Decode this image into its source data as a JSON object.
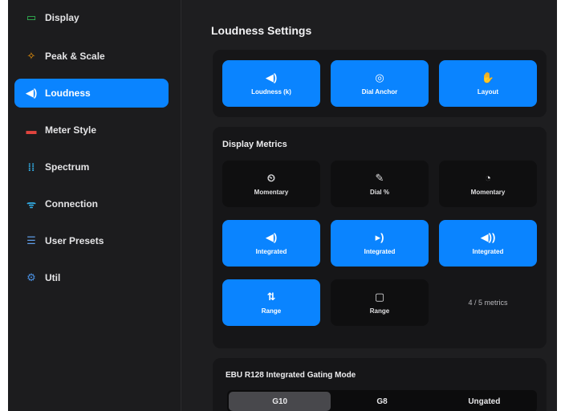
{
  "sidebar": {
    "items": [
      {
        "label": "Display",
        "icon": "monitor-icon",
        "color": "#34c759",
        "glyph": "▭"
      },
      {
        "label": "Peak & Scale",
        "icon": "peak-scale-icon",
        "color": "#ff9f0a",
        "glyph": "✧"
      },
      {
        "label": "Loudness",
        "icon": "speaker-icon",
        "color": "#ffffff",
        "glyph": "◀)"
      },
      {
        "label": "Meter Style",
        "icon": "meter-style-icon",
        "color": "#e0443e",
        "glyph": "▬"
      },
      {
        "label": "Spectrum",
        "icon": "spectrum-icon",
        "color": "#32ade6",
        "glyph": "⁞⁞"
      },
      {
        "label": "Connection",
        "icon": "wifi-icon",
        "color": "#32ade6",
        "glyph": "ᯤ"
      },
      {
        "label": "User Presets",
        "icon": "presets-icon",
        "color": "#5e9ce6",
        "glyph": "☰"
      },
      {
        "label": "Util",
        "icon": "wrench-icon",
        "color": "#4a90e2",
        "glyph": "⚙"
      }
    ],
    "active_index": 2
  },
  "main": {
    "title": "Loudness Settings",
    "mode_tiles": [
      {
        "label": "Loudness (k)",
        "glyph": "◀)",
        "icon": "speaker-icon",
        "on": true
      },
      {
        "label": "Dial Anchor",
        "glyph": "◎",
        "icon": "dial-anchor-icon",
        "on": true
      },
      {
        "label": "Layout",
        "glyph": "✋",
        "icon": "hand-icon",
        "on": true
      }
    ],
    "metrics": {
      "title": "Display Metrics",
      "tiles": [
        {
          "label": "Momentary",
          "glyph": "⏲",
          "icon": "timer-icon",
          "on": false
        },
        {
          "label": "Dial %",
          "glyph": "✎",
          "icon": "dial-percent-icon",
          "on": false
        },
        {
          "label": "Momentary",
          "glyph": "◔",
          "icon": "clock-icon",
          "on": false
        },
        {
          "label": "Integrated",
          "glyph": "◀)",
          "icon": "speaker-icon",
          "on": true
        },
        {
          "label": "Integrated",
          "glyph": "▸)",
          "icon": "speaker-small-icon",
          "on": true
        },
        {
          "label": "Integrated",
          "glyph": "◀))",
          "icon": "speaker-wave-icon",
          "on": true
        },
        {
          "label": "Range",
          "glyph": "⇅",
          "icon": "range-icon",
          "on": true
        },
        {
          "label": "Range",
          "glyph": "▢",
          "icon": "message-icon",
          "on": false
        }
      ],
      "count": "4 / 5 metrics"
    },
    "gating": {
      "title": "EBU R128 Integrated Gating Mode",
      "options": [
        "G10",
        "G8",
        "Ungated"
      ],
      "selected_index": 0
    }
  }
}
